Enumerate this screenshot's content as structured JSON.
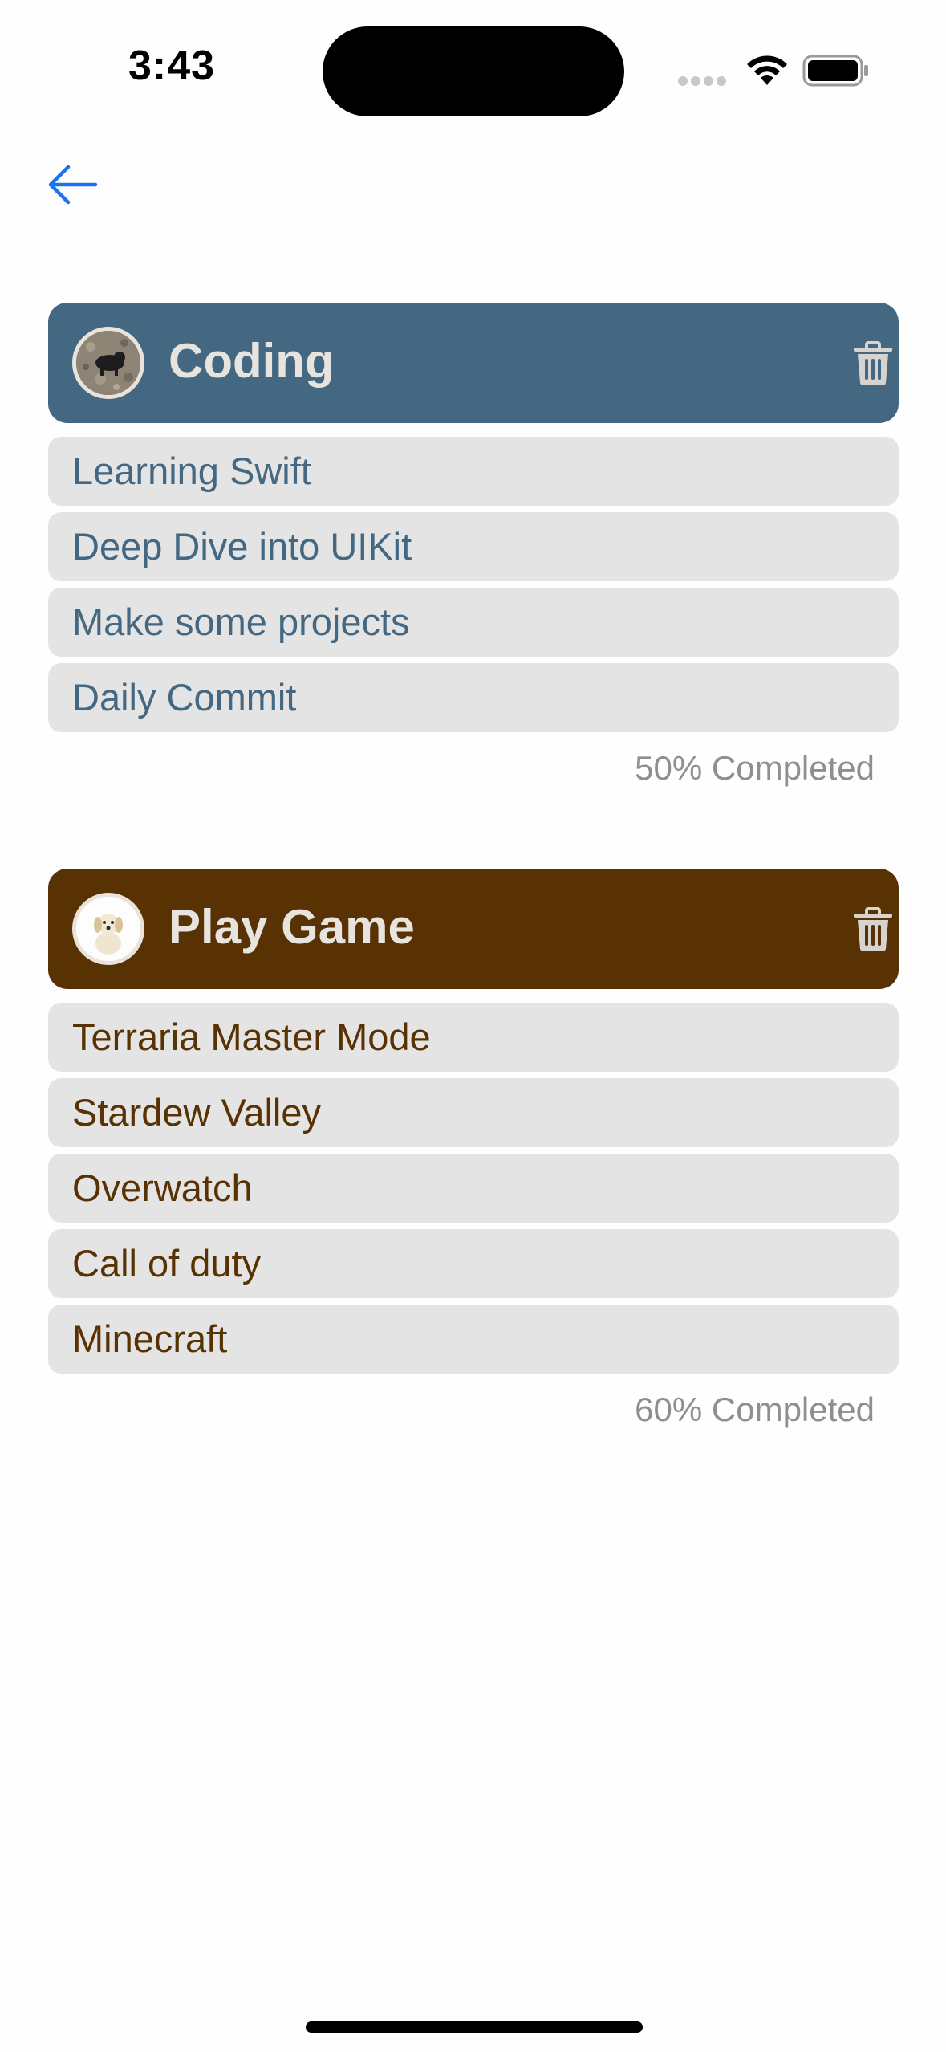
{
  "status_bar": {
    "time": "3:43"
  },
  "nav": {
    "back_icon": "arrow-left-icon",
    "accent": "#1a73e8"
  },
  "sections": [
    {
      "title": "Coding",
      "header_color": "#446882",
      "text_color": "#446882",
      "avatar": "dog-photo",
      "tasks": [
        "Learning Swift",
        "Deep Dive into UIKit",
        "Make some projects",
        "Daily Commit"
      ],
      "progress_text": "50% Completed"
    },
    {
      "title": "Play Game",
      "header_color": "#583203",
      "text_color": "#583203",
      "avatar": "puppy-photo",
      "tasks": [
        "Terraria Master Mode",
        "Stardew Valley",
        "Overwatch",
        "Call of duty",
        "Minecraft"
      ],
      "progress_text": "60% Completed"
    }
  ]
}
